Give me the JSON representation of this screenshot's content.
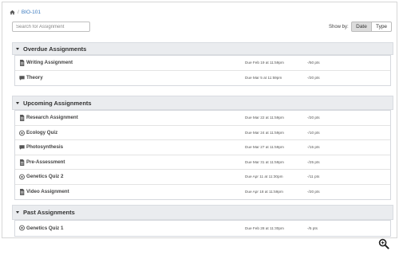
{
  "breadcrumb": {
    "course": "BIO-101"
  },
  "search": {
    "placeholder": "Search for Assignment"
  },
  "show_by": {
    "label": "Show by:",
    "options": [
      "Date",
      "Type"
    ],
    "selected": "Date"
  },
  "groups": [
    {
      "title": "Overdue Assignments",
      "items": [
        {
          "icon": "document-icon",
          "name": "Writing Assignment",
          "due": "Due Feb 19 at 11:59pm",
          "pts": "-/50 pts"
        },
        {
          "icon": "discussion-icon",
          "name": "Theory",
          "due": "Due Mar 5 at 11:59pm",
          "pts": "-/20 pts"
        }
      ]
    },
    {
      "title": "Upcoming Assignments",
      "items": [
        {
          "icon": "document-icon",
          "name": "Research Assignment",
          "due": "Due Mar 22 at 11:59pm",
          "pts": "-/20 pts"
        },
        {
          "icon": "quiz-icon",
          "name": "Ecology Quiz",
          "due": "Due Mar 24 at 11:59pm",
          "pts": "-/10 pts"
        },
        {
          "icon": "discussion-icon",
          "name": "Photosynthesis",
          "due": "Due Mar 27 at 11:59pm",
          "pts": "-/15 pts"
        },
        {
          "icon": "document-icon",
          "name": "Pre-Assessment",
          "due": "Due Mar 31 at 11:59pm",
          "pts": "-/25 pts"
        },
        {
          "icon": "quiz-icon",
          "name": "Genetics Quiz 2",
          "due": "Due Apr 11 at 11:30pm",
          "pts": "-/11 pts"
        },
        {
          "icon": "document-icon",
          "name": "Video Assignment",
          "due": "Due Apr 18 at 11:59pm",
          "pts": "-/20 pts"
        }
      ]
    },
    {
      "title": "Past Assignments",
      "items": [
        {
          "icon": "quiz-icon",
          "name": "Genetics Quiz 1",
          "due": "Due Feb 28 at 11:30pm",
          "pts": "-/5 pts"
        }
      ]
    }
  ]
}
